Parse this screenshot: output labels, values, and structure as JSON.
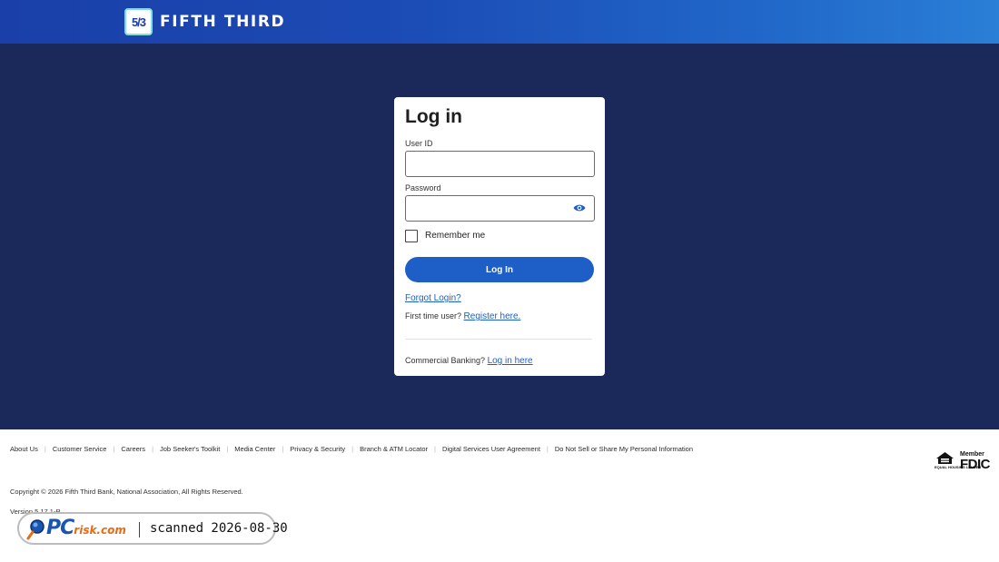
{
  "header": {
    "logo_mark": "5/3",
    "brand_name": "FIFTH THIRD"
  },
  "login": {
    "title": "Log in",
    "user_id_label": "User ID",
    "user_id_value": "",
    "password_label": "Password",
    "password_value": "",
    "remember_me_label": "Remember me",
    "remember_me_checked": false,
    "login_button": "Log In",
    "forgot_login": "Forgot Login?",
    "first_time_text": "First time user?",
    "register_link": "Register here.",
    "commercial_text": "Commercial Banking?",
    "commercial_link": "Log in here"
  },
  "footer": {
    "links": [
      "About Us",
      "Customer Service",
      "Careers",
      "Job Seeker's Toolkit",
      "Media Center",
      "Privacy & Security",
      "Branch & ATM Locator",
      "Digital Services User Agreement",
      "Do Not Sell or Share My Personal Information"
    ],
    "copyright": "Copyright © 2026 Fifth Third Bank, National Association, All Rights Reserved.",
    "version": "Version 5.17.1-P",
    "equal_housing_text": "EQUAL HOUSING LENDER",
    "fdic_member": "Member",
    "fdic": "FDIC"
  },
  "badge": {
    "brand": "PC",
    "brand_suffix": "risk.com",
    "scan_text": "scanned 2026-08-30"
  },
  "colors": {
    "header_gradient_start": "#1a3fa8",
    "header_gradient_end": "#2a7fd6",
    "background_navy": "#1b285a",
    "accent_blue": "#1e5ec7",
    "logo_teal": "#7fe0d8"
  },
  "icons": {
    "password_toggle": "eye-icon",
    "badge": "magnifier-icon"
  }
}
